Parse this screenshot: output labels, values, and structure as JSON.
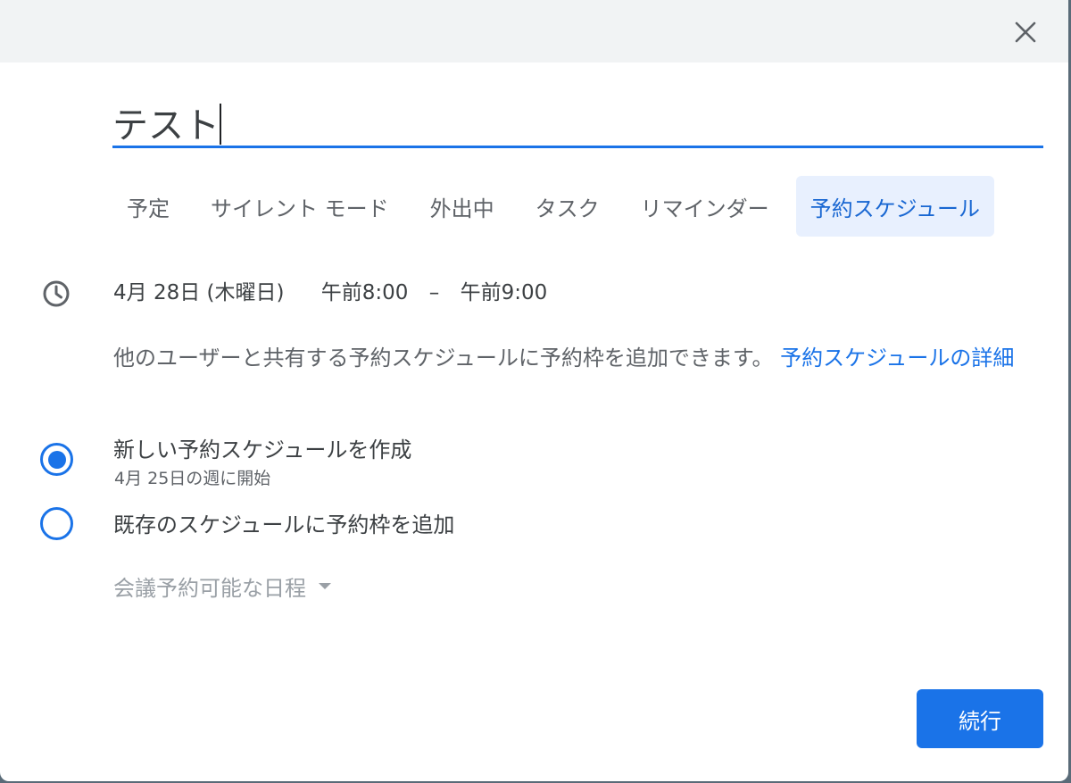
{
  "title_input": {
    "value": "テスト"
  },
  "tabs": [
    {
      "label": "予定",
      "active": false
    },
    {
      "label": "サイレント モード",
      "active": false
    },
    {
      "label": "外出中",
      "active": false
    },
    {
      "label": "タスク",
      "active": false
    },
    {
      "label": "リマインダー",
      "active": false
    },
    {
      "label": "予約スケジュール",
      "active": true
    }
  ],
  "datetime": {
    "date": "4月 28日 (木曜日)",
    "start": "午前8:00",
    "separator": "–",
    "end": "午前9:00"
  },
  "info": {
    "text": "他のユーザーと共有する予約スケジュールに予約枠を追加できます。",
    "link": "予約スケジュールの詳細"
  },
  "options": [
    {
      "label": "新しい予約スケジュールを作成",
      "sublabel": "4月 25日の週に開始",
      "selected": true
    },
    {
      "label": "既存のスケジュールに予約枠を追加",
      "selected": false
    }
  ],
  "dropdown": {
    "label": "会議予約可能な日程"
  },
  "continue_button": {
    "label": "続行"
  },
  "colors": {
    "accent": "#1a73e8",
    "active_tab_bg": "#e8f0fe",
    "topbar_bg": "#f1f3f4"
  }
}
